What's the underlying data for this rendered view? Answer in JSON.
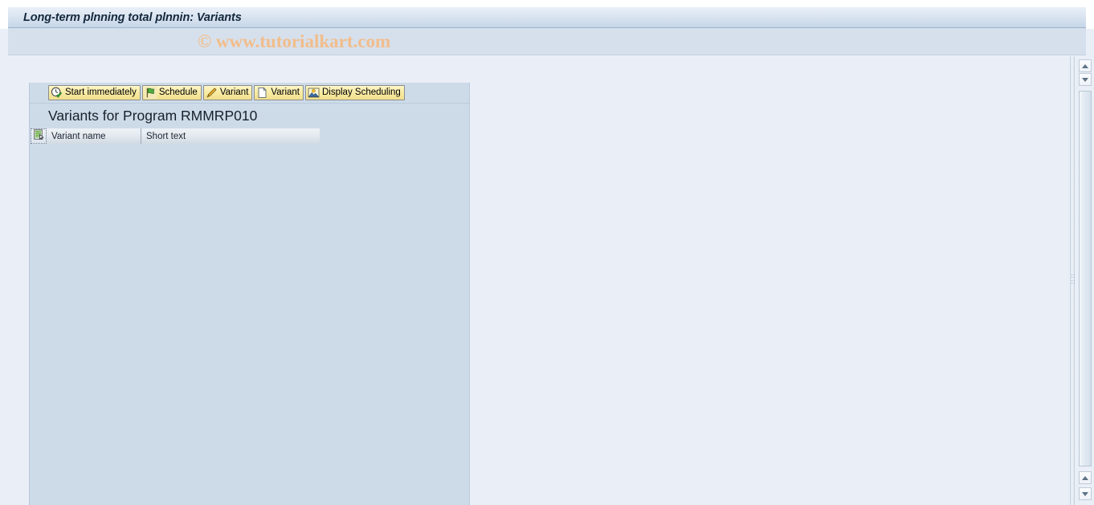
{
  "window": {
    "title": "Long-term plnning total plnnin: Variants"
  },
  "watermark": {
    "text": "© www.tutorialkart.com",
    "color": "#f2bd8b"
  },
  "toolbar": {
    "buttons": [
      {
        "label": "Start immediately",
        "icon": "clock-check-icon"
      },
      {
        "label": "Schedule",
        "icon": "green-flag-icon"
      },
      {
        "label": "Variant",
        "icon": "pencil-icon"
      },
      {
        "label": "Variant",
        "icon": "blank-page-icon"
      },
      {
        "label": "Display Scheduling",
        "icon": "picture-mountain-icon"
      }
    ]
  },
  "panel": {
    "headline": "Variants for Program RMMRP010",
    "select_all_icon": "select-all-list-icon",
    "columns": [
      {
        "label": "Variant name"
      },
      {
        "label": "Short text"
      }
    ],
    "rows": []
  },
  "scrollbars": {
    "outer": {
      "up_icon": "arrow-up-icon",
      "down_icon": "arrow-down-icon"
    },
    "inner": {
      "up_icon": "arrow-up-icon",
      "down_icon": "arrow-down-icon"
    }
  },
  "theme": {
    "page_bg": "#eaeff7",
    "panel_bg": "#cddbe9",
    "title_text": "#14283c",
    "button_face": "#f7e9a0"
  }
}
